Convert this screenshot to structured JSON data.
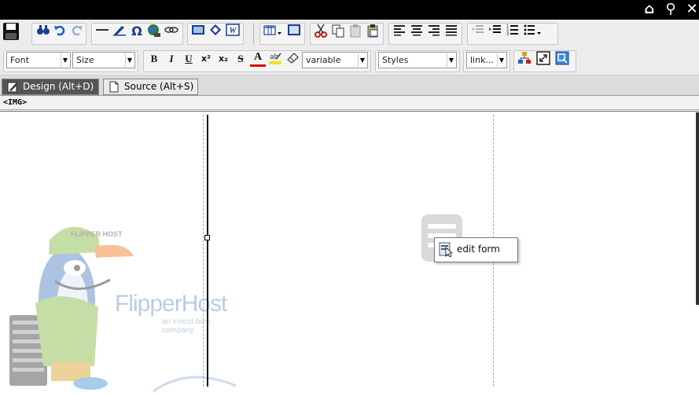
{
  "topbar": {
    "icons": [
      "home-icon",
      "search-icon",
      "close-icon"
    ]
  },
  "toolbar1": {
    "buttons": [
      "save-icon",
      "find-icon",
      "undo-icon",
      "redo-icon",
      "horizontal-rule-icon",
      "pen-icon",
      "special-char-icon",
      "web-icon",
      "unlink-icon",
      "image-icon",
      "media-icon",
      "word-paste-icon",
      "table-icon",
      "preview-icon",
      "cut-icon",
      "copy-icon",
      "paste-icon",
      "paste-text-icon",
      "align-left-icon",
      "align-center-icon",
      "align-right-icon",
      "justify-icon",
      "outdent-icon",
      "indent-icon",
      "ordered-list-icon",
      "unordered-list-icon"
    ]
  },
  "toolbar2": {
    "font_select": "Font",
    "size_select": "Size",
    "format_buttons": {
      "bold": "B",
      "italic": "I",
      "underline": "U",
      "superscript": "x²",
      "subscript": "x₂",
      "strike": "S",
      "font_color": "A"
    },
    "variable_select": "variable",
    "styles_select": "Styles",
    "link_select": "link..."
  },
  "tabs": {
    "design": "Design (Alt+D)",
    "source": "Source (Alt+S)"
  },
  "pathbar": {
    "tag": "<IMG>"
  },
  "context_menu": {
    "label": "edit form"
  },
  "logo": {
    "brand": "FlipperHost",
    "tagline": "an invest bien company",
    "cap_text": "FLIPPER HOST"
  },
  "colors": {
    "topbar": "#000000",
    "toolbar_bg": "#ececec",
    "icon_blue": "#1a3d8f",
    "tab_active": "#555555"
  }
}
